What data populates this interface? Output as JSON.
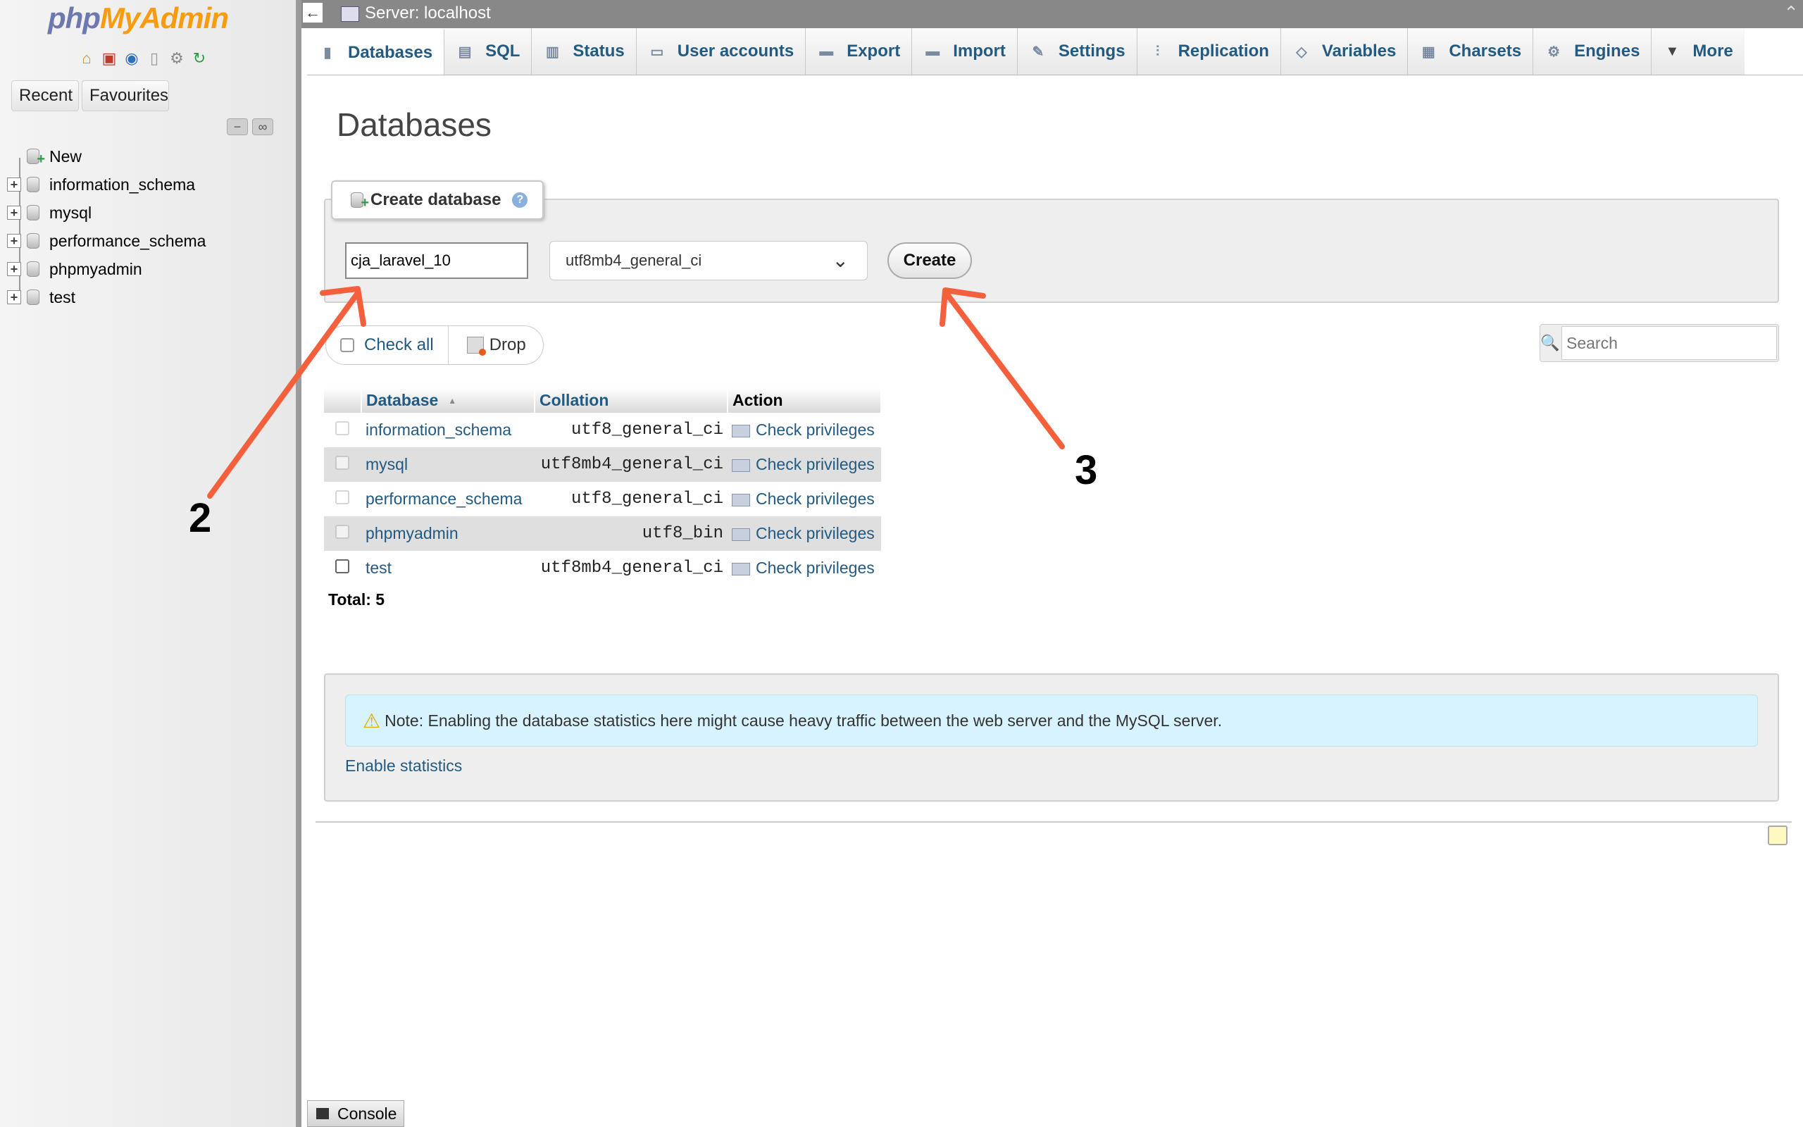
{
  "app": {
    "logo_php": "php",
    "logo_myadmin": "MyAdmin",
    "server_title": "Server: localhost"
  },
  "nav": {
    "recent": "Recent",
    "favourites": "Favourites",
    "tree": [
      {
        "label": "New",
        "kind": "new"
      },
      {
        "label": "information_schema",
        "kind": "db"
      },
      {
        "label": "mysql",
        "kind": "db"
      },
      {
        "label": "performance_schema",
        "kind": "db"
      },
      {
        "label": "phpmyadmin",
        "kind": "db"
      },
      {
        "label": "test",
        "kind": "db"
      }
    ]
  },
  "tabs": [
    {
      "label": "Databases",
      "icon": "database-icon",
      "glyph": "▮"
    },
    {
      "label": "SQL",
      "icon": "sql-icon",
      "glyph": "▤"
    },
    {
      "label": "Status",
      "icon": "status-icon",
      "glyph": "▥"
    },
    {
      "label": "User accounts",
      "icon": "users-icon",
      "glyph": "▭"
    },
    {
      "label": "Export",
      "icon": "export-icon",
      "glyph": "▬"
    },
    {
      "label": "Import",
      "icon": "import-icon",
      "glyph": "▬"
    },
    {
      "label": "Settings",
      "icon": "wrench-icon",
      "glyph": "✎"
    },
    {
      "label": "Replication",
      "icon": "replication-icon",
      "glyph": "⫶"
    },
    {
      "label": "Variables",
      "icon": "variables-icon",
      "glyph": "◇"
    },
    {
      "label": "Charsets",
      "icon": "charsets-icon",
      "glyph": "▦"
    },
    {
      "label": "Engines",
      "icon": "engines-icon",
      "glyph": "⚙"
    },
    {
      "label": "More",
      "icon": "triangle-down-icon",
      "glyph": "▼"
    }
  ],
  "main": {
    "page_title": "Databases",
    "create_legend": "Create database",
    "db_name_value": "cja_laravel_10",
    "collation_value": "utf8mb4_general_ci",
    "create_label": "Create",
    "check_all": "Check all",
    "drop": "Drop",
    "search_placeholder": "Search",
    "table": {
      "headers": {
        "database": "Database",
        "collation": "Collation",
        "action": "Action"
      },
      "rows": [
        {
          "name": "information_schema",
          "collation": "utf8_general_ci",
          "action": "Check privileges"
        },
        {
          "name": "mysql",
          "collation": "utf8mb4_general_ci",
          "action": "Check privileges"
        },
        {
          "name": "performance_schema",
          "collation": "utf8_general_ci",
          "action": "Check privileges"
        },
        {
          "name": "phpmyadmin",
          "collation": "utf8_bin",
          "action": "Check privileges"
        },
        {
          "name": "test",
          "collation": "utf8mb4_general_ci",
          "action": "Check privileges"
        }
      ]
    },
    "total": "Total: 5",
    "notice": "Note: Enabling the database statistics here might cause heavy traffic between the web server and the MySQL server.",
    "enable_stats": "Enable statistics",
    "console": "Console"
  },
  "annotations": {
    "label_2": "2",
    "label_3": "3",
    "arrow_color": "#f4603c"
  },
  "colors": {
    "link": "#235a81",
    "notice_bg": "#d6f3ff",
    "topbar": "#888888"
  }
}
